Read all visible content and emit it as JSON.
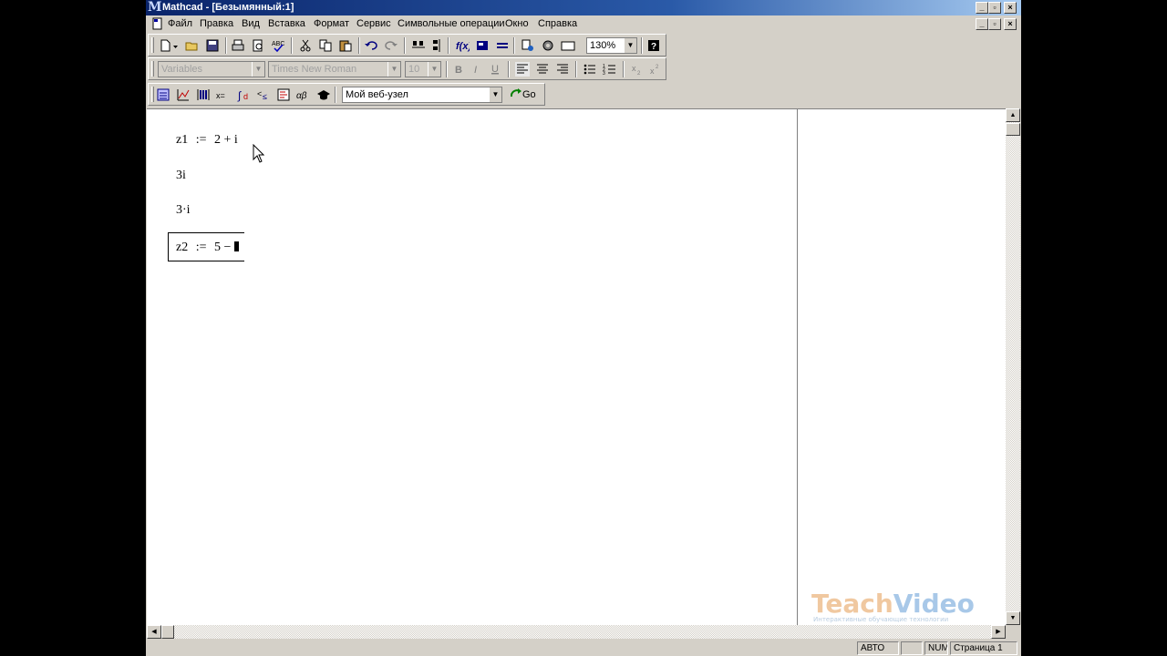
{
  "window": {
    "title": "Mathcad - [Безымянный:1]",
    "controls": [
      "minimize-icon",
      "restore-icon",
      "close-icon"
    ]
  },
  "menu": {
    "items": [
      "Файл",
      "Правка",
      "Вид",
      "Вставка",
      "Формат",
      "Сервис",
      "Символьные операции",
      "Окно",
      "Справка"
    ]
  },
  "toolbar_standard": {
    "zoom": "130%"
  },
  "toolbar_formatting": {
    "style": "Variables",
    "font": "Times New Roman",
    "size": "10"
  },
  "toolbar_math": {
    "web_location": "Мой веб-узел",
    "go_label": "Go"
  },
  "worksheet": {
    "regions": [
      {
        "parts": [
          "z1",
          ":=",
          "2 + i"
        ]
      },
      {
        "parts": [
          "3i"
        ]
      },
      {
        "parts": [
          "3·i"
        ]
      },
      {
        "parts": [
          "z2",
          ":=",
          "5 −"
        ],
        "selected": true
      }
    ]
  },
  "status": {
    "mode": "АВТО",
    "num": "NUM",
    "page": "Страница 1"
  },
  "watermark": {
    "brand_a": "Teach",
    "brand_b": "Video",
    "tagline": "Интерактивные обучающие технологии"
  },
  "colors": {
    "title_start": "#0a246a",
    "title_end": "#a6caf0",
    "chrome": "#d4d0c8",
    "watermark_teach": "#f0c8a0",
    "watermark_video": "#a8c8e8"
  }
}
